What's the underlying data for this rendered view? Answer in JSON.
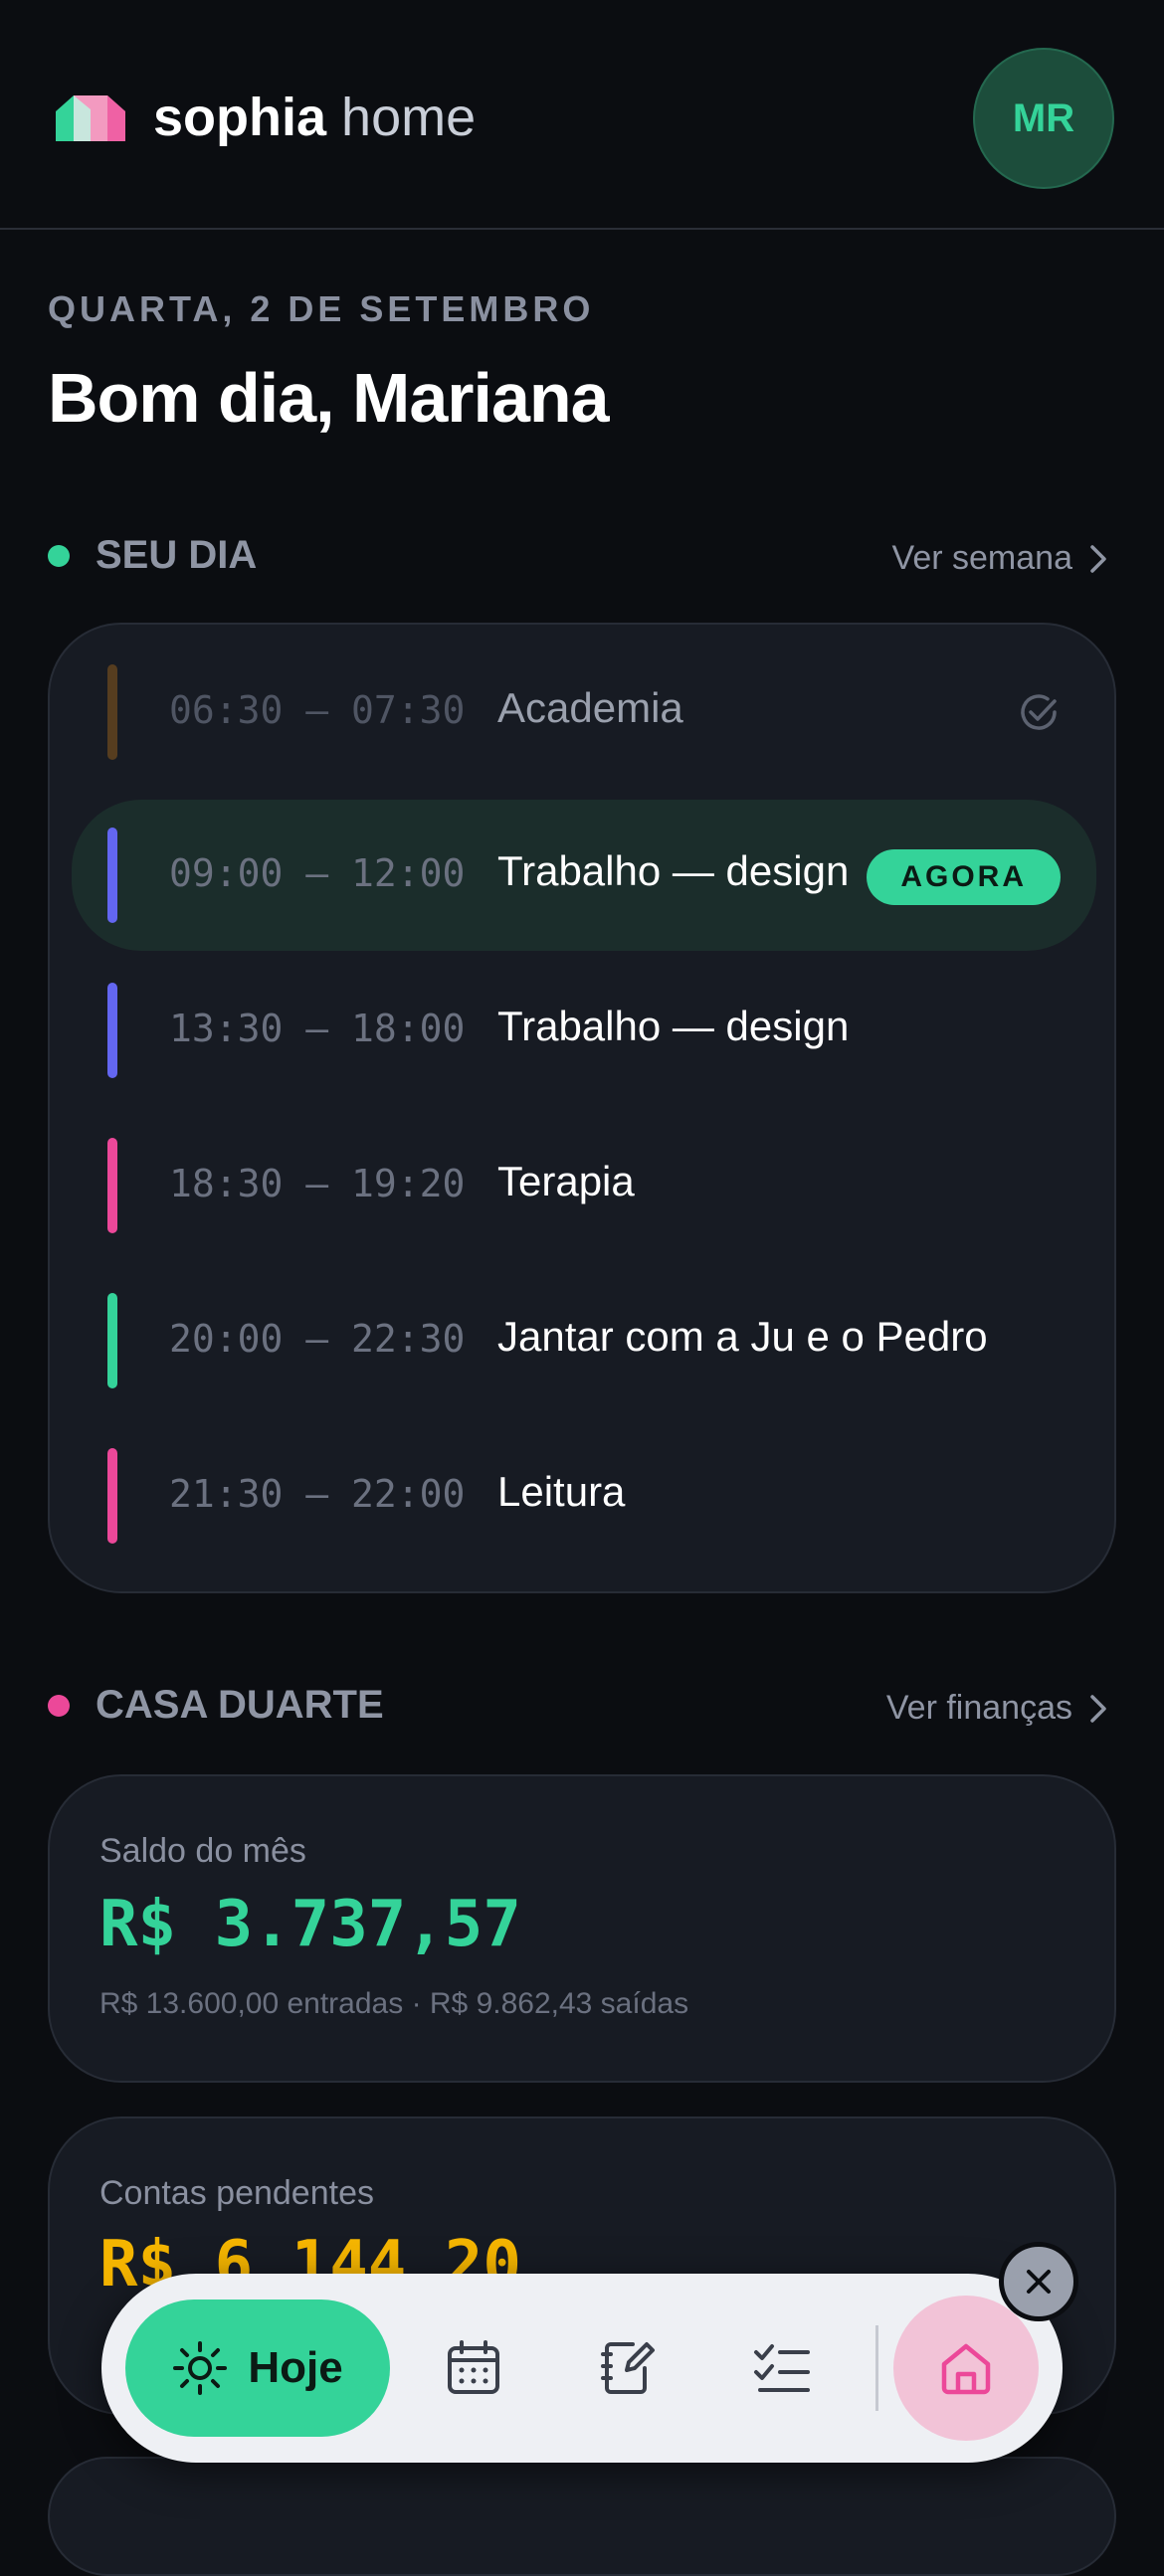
{
  "header": {
    "brand_bold": "sophia",
    "brand_light": "home",
    "avatar_initials": "MR"
  },
  "today": {
    "date": "QUARTA, 2 DE SETEMBRO",
    "greeting": "Bom dia, Mariana"
  },
  "day_section": {
    "title": "SEU DIA",
    "link": "Ver semana",
    "events": [
      {
        "time": "06:30 – 07:30",
        "title": "Academia",
        "color": "#8a5a1e",
        "status": "done"
      },
      {
        "time": "09:00 – 12:00",
        "title": "Trabalho — design",
        "color": "#6366f1",
        "status": "current",
        "badge": "AGORA"
      },
      {
        "time": "13:30 – 18:00",
        "title": "Trabalho — design",
        "color": "#6366f1"
      },
      {
        "time": "18:30 – 19:20",
        "title": "Terapia",
        "color": "#ec4899"
      },
      {
        "time": "20:00 – 22:30",
        "title": "Jantar com a Ju e o Pedro",
        "color": "#34d399"
      },
      {
        "time": "21:30 – 22:00",
        "title": "Leitura",
        "color": "#ec4899"
      }
    ]
  },
  "home_section": {
    "title": "CASA DUARTE",
    "link": "Ver finanças",
    "balance": {
      "label": "Saldo do mês",
      "amount": "R$ 3.737,57",
      "detail": "R$ 13.600,00 entradas · R$ 9.862,43 saídas"
    },
    "pending": {
      "label": "Contas pendentes",
      "amount": "R$ 6.144,20"
    }
  },
  "nav": {
    "active_label": "Hoje"
  },
  "colors": {
    "accent_green": "#34d399",
    "accent_pink": "#ec4899",
    "accent_amber": "#f5b500"
  }
}
